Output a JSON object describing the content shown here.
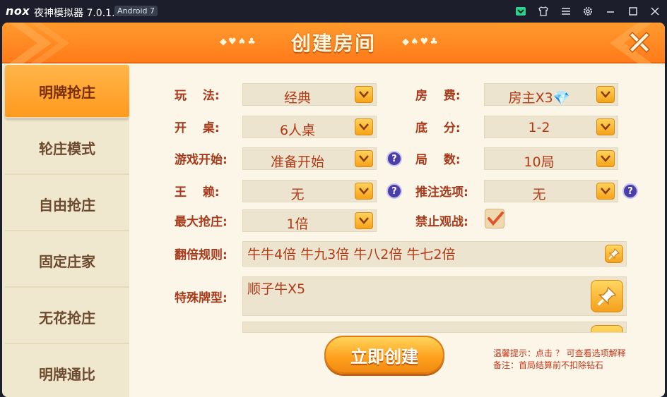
{
  "titlebar": {
    "logo": "nox",
    "app_title": "夜神模拟器 7.0.1.0",
    "android_version": "Android 7"
  },
  "header": {
    "title": "创建房间",
    "left_suits": "◆♥♠♣",
    "right_suits": "◆♠♥♣"
  },
  "sidebar": {
    "items": [
      {
        "label": "明牌抢庄",
        "active": true
      },
      {
        "label": "轮庄模式",
        "active": false
      },
      {
        "label": "自由抢庄",
        "active": false
      },
      {
        "label": "固定庄家",
        "active": false
      },
      {
        "label": "无花抢庄",
        "active": false
      },
      {
        "label": "明牌通比",
        "active": false
      }
    ]
  },
  "form": {
    "play_mode": {
      "label": "玩　 法:",
      "value": "经典"
    },
    "room_fee": {
      "label": "房　 费:",
      "value": "房主X3💎"
    },
    "table": {
      "label": "开　 桌:",
      "value": "6人桌"
    },
    "base_score": {
      "label": "底　 分:",
      "value": "1-2"
    },
    "game_start": {
      "label": "游戏开始:",
      "value": "准备开始"
    },
    "rounds": {
      "label": "局　 数:",
      "value": "10局"
    },
    "wild": {
      "label": "王　 赖:",
      "value": "无"
    },
    "push_bet": {
      "label": "推注选项:",
      "value": "无"
    },
    "max_grab": {
      "label": "最大抢庄:",
      "value": "1倍"
    },
    "no_spectate": {
      "label": "禁止观战:",
      "checked": true
    },
    "multiplier_rules": {
      "label": "翻倍规则:",
      "value": "牛牛4倍 牛九3倍 牛八2倍 牛七2倍"
    },
    "special_cards": {
      "label": "特殊牌型:",
      "value": "顺子牛X5"
    },
    "help_symbol": "?"
  },
  "create_button": {
    "label": "立即创建"
  },
  "hints": {
    "line1": "温馨提示：点击 ？ 可查看选项解释",
    "line2": "备注：首局结算前不扣除钻石"
  },
  "colors": {
    "header_orange": "#ff8a22",
    "label_red": "#a8391a",
    "value_red": "#b23a14",
    "panel_bg": "#fbf6e8",
    "help_purple": "#4a3fa8"
  }
}
